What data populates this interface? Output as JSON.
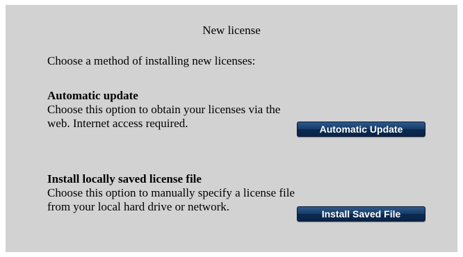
{
  "dialog": {
    "title": "New license",
    "intro": "Choose a method of installing new licenses:"
  },
  "options": [
    {
      "heading": "Automatic update",
      "description": "Choose this option to obtain your licenses via the web. Internet access required.",
      "button_label": "Automatic Update"
    },
    {
      "heading": "Install locally saved license file",
      "description": "Choose this option to manually specify a license file from your local hard drive or network.",
      "button_label": "Install Saved File"
    }
  ],
  "colors": {
    "panel_background": "#d2d2d2",
    "button_background": "#173a66",
    "button_text": "#ffffff"
  }
}
